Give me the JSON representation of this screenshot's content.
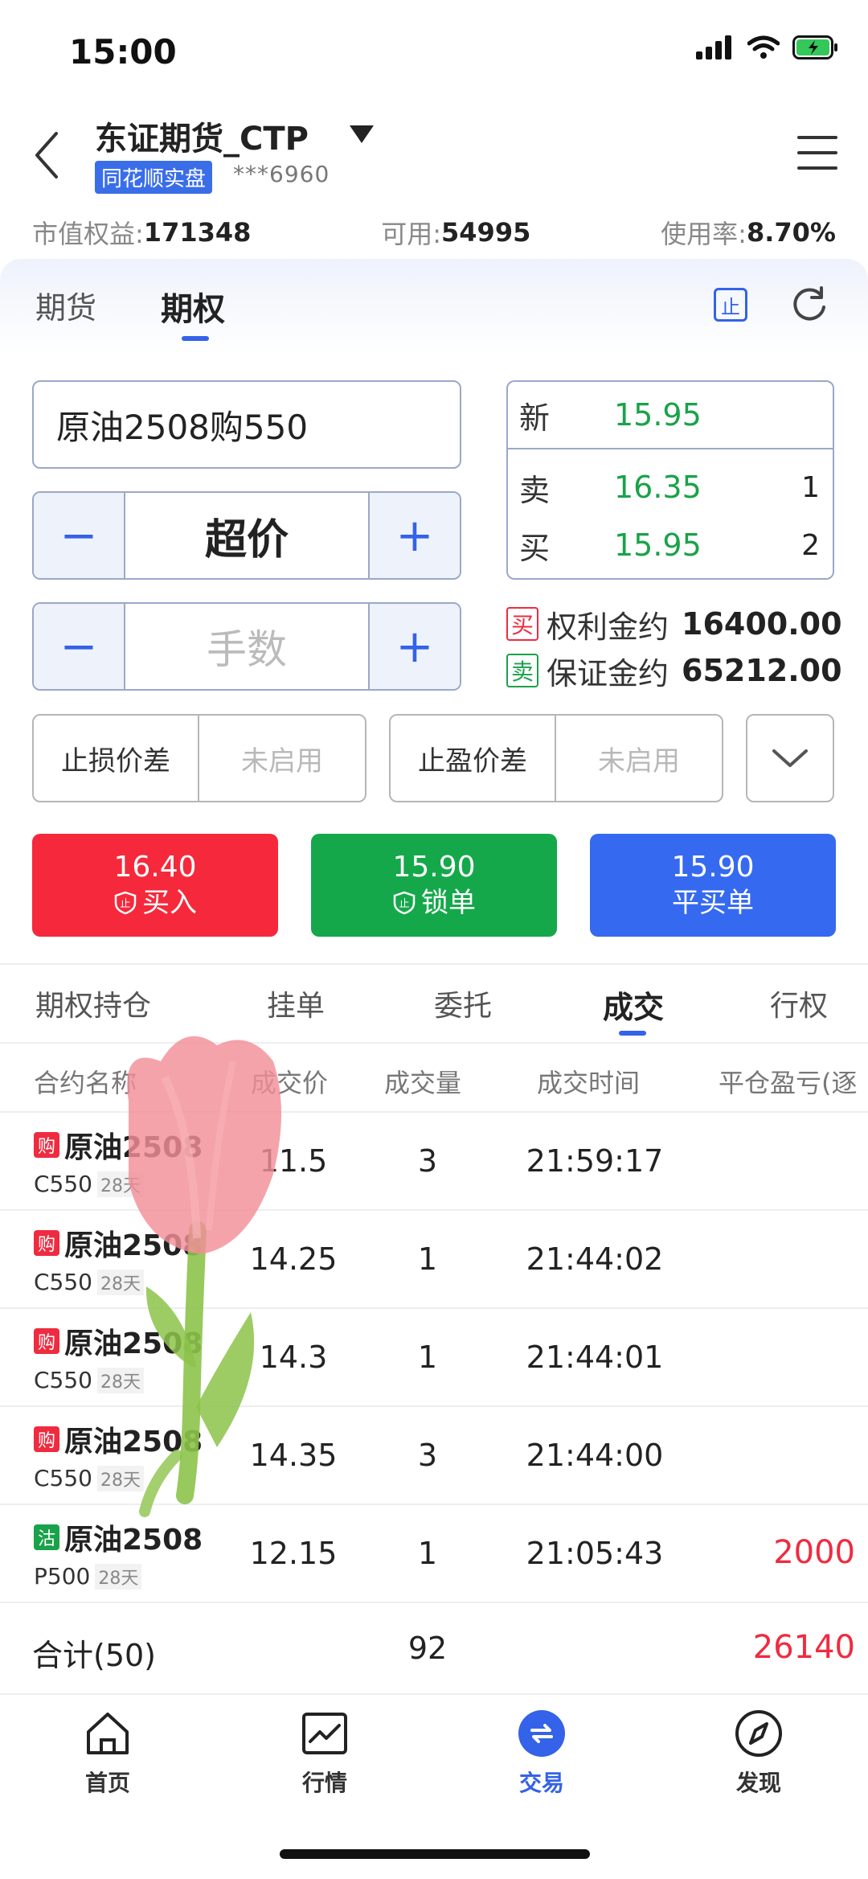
{
  "status_bar": {
    "time": "15:00"
  },
  "header": {
    "account_title": "东证期货_CTP",
    "badge": "同花顺实盘",
    "account_no": "***6960"
  },
  "summary": [
    {
      "label": "市值权益:",
      "value": "171348"
    },
    {
      "label": "可用:",
      "value": "54995"
    },
    {
      "label": "使用率:",
      "value": "8.70%"
    }
  ],
  "top_tabs": {
    "futures": "期货",
    "options": "期权",
    "active": "期权"
  },
  "stop_icon_text": "止",
  "order": {
    "contract": "原油2508购550",
    "price_mode": "超价",
    "qty_placeholder": "手数",
    "minus": "−",
    "plus": "+"
  },
  "quote": {
    "last_label": "新",
    "last_price": "15.95",
    "ask_label": "卖",
    "ask_price": "16.35",
    "ask_vol": "1",
    "bid_label": "买",
    "bid_price": "15.95",
    "bid_vol": "2"
  },
  "margin": [
    {
      "tag": "买",
      "label": "权利金约",
      "value": "16400.00",
      "color": "#ef2b40"
    },
    {
      "tag": "卖",
      "label": "保证金约",
      "value": "65212.00",
      "color": "#1aa24a"
    }
  ],
  "stops": {
    "loss_label": "止损价差",
    "loss_value": "未启用",
    "profit_label": "止盈价差",
    "profit_value": "未启用"
  },
  "actions": [
    {
      "price": "16.40",
      "label": "买入"
    },
    {
      "price": "15.90",
      "label": "锁单"
    },
    {
      "price": "15.90",
      "label": "平买单"
    }
  ],
  "lower_tabs": [
    "期权持仓",
    "挂单",
    "委托",
    "成交",
    "行权"
  ],
  "lower_tabs_active": "成交",
  "table": {
    "headers": [
      "合约名称",
      "成交价",
      "成交量",
      "成交时间",
      "平仓盈亏(逐"
    ],
    "rows": [
      {
        "tag": "购",
        "tag_color": "#ef2b40",
        "name": "原油2508",
        "code": "C550",
        "days": "28天",
        "price": "11.5",
        "qty": "3",
        "time": "21:59:17",
        "pnl": ""
      },
      {
        "tag": "购",
        "tag_color": "#ef2b40",
        "name": "原油2508",
        "code": "C550",
        "days": "28天",
        "price": "14.25",
        "qty": "1",
        "time": "21:44:02",
        "pnl": ""
      },
      {
        "tag": "购",
        "tag_color": "#ef2b40",
        "name": "原油2508",
        "code": "C550",
        "days": "28天",
        "price": "14.3",
        "qty": "1",
        "time": "21:44:01",
        "pnl": ""
      },
      {
        "tag": "购",
        "tag_color": "#ef2b40",
        "name": "原油2508",
        "code": "C550",
        "days": "28天",
        "price": "14.35",
        "qty": "3",
        "time": "21:44:00",
        "pnl": ""
      },
      {
        "tag": "沽",
        "tag_color": "#1aa24a",
        "name": "原油2508",
        "code": "P500",
        "days": "28天",
        "price": "12.15",
        "qty": "1",
        "time": "21:05:43",
        "pnl": "2000"
      }
    ],
    "total": {
      "label": "合计(50)",
      "qty": "92",
      "pnl": "26140"
    }
  },
  "bottom_nav": [
    "首页",
    "行情",
    "交易",
    "发现"
  ],
  "bottom_nav_active": "交易",
  "colors": {
    "accent": "#3462e8",
    "buy": "#f5293b",
    "sell": "#14a84a",
    "close": "#356af0"
  }
}
